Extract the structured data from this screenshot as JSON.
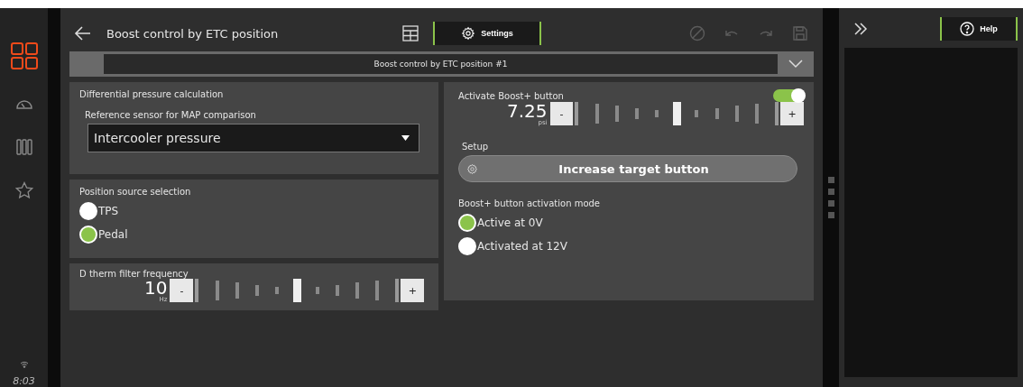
{
  "nav": {
    "items": [
      {
        "kind": "apps",
        "selected": true
      },
      {
        "kind": "gauge",
        "selected": false
      },
      {
        "kind": "columns",
        "selected": false
      },
      {
        "kind": "star",
        "selected": false
      }
    ],
    "time": "8:03"
  },
  "header": {
    "title": "Boost control by ETC position",
    "tabs": [
      {
        "kind": "table",
        "selected": false
      },
      {
        "kind": "settings",
        "label": "Settings",
        "selected": true
      }
    ]
  },
  "selector": {
    "value": "Boost control by ETC position #1"
  },
  "differential": {
    "title": "Differential pressure calculation",
    "label": "Reference sensor for MAP comparison",
    "value": "Intercooler pressure"
  },
  "position_source": {
    "title": "Position source selection",
    "options": [
      {
        "label": "TPS",
        "selected": false
      },
      {
        "label": "Pedal",
        "selected": true
      }
    ]
  },
  "d_therm": {
    "title": "D therm filter frequency",
    "value": "10",
    "unit": "Hz",
    "level": 0.5,
    "minus": "-",
    "plus": "+"
  },
  "boost": {
    "title": "Activate Boost+ button",
    "on": true,
    "value": "7.25",
    "unit": "psi",
    "level": 0.5,
    "minus": "-",
    "plus": "+",
    "setup_label": "Setup",
    "setup_button": "Increase target button",
    "mode_title": "Boost+ button activation mode",
    "modes": [
      {
        "label": "Active at 0V",
        "selected": true
      },
      {
        "label": "Activated at 12V",
        "selected": false
      }
    ]
  },
  "help": {
    "label": "Help"
  }
}
